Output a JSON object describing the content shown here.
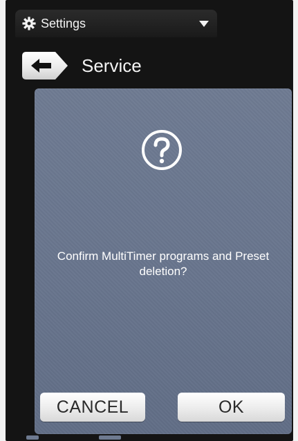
{
  "header": {
    "menu_title": "Settings",
    "menu_icon": "gear-icon",
    "dropdown_icon": "dropdown-arrow-icon"
  },
  "page": {
    "title": "Service",
    "back_icon": "back-arrow-icon"
  },
  "dialog": {
    "icon": "question-mark-icon",
    "message": "Confirm MultiTimer programs and Preset deletion?",
    "cancel_label": "CANCEL",
    "ok_label": "OK"
  },
  "colors": {
    "background": "#141414",
    "dialog": "#68758d",
    "button": "#f2f2f2",
    "text_light": "#ffffff",
    "text_dark": "#2a2a2a"
  }
}
